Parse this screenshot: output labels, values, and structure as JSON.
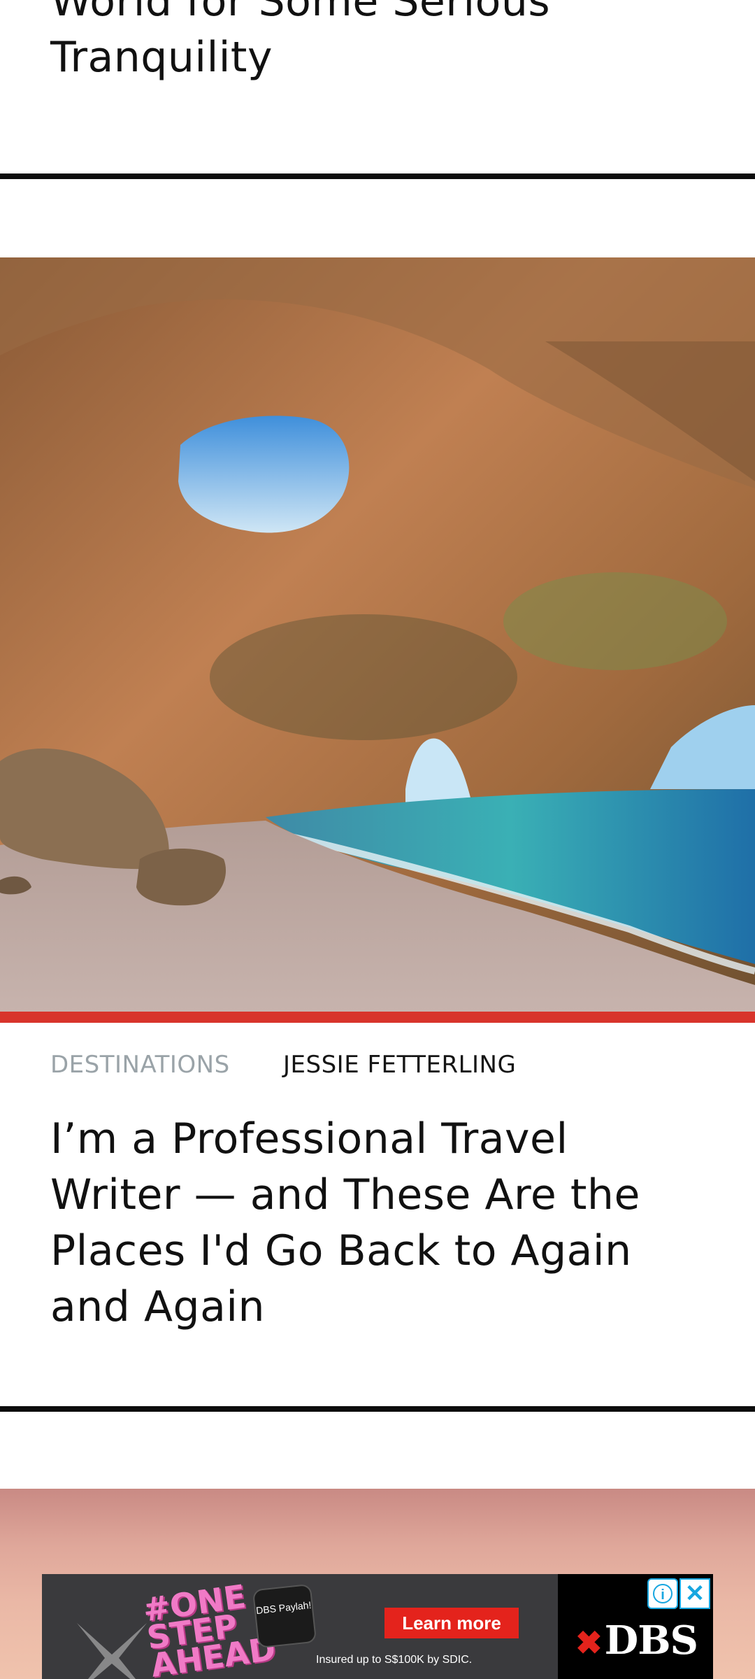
{
  "articles": [
    {
      "title": "World for Some Serious Tranquility"
    },
    {
      "category": "DESTINATIONS",
      "author": "JESSIE FETTERLING",
      "title": "I’m a Professional Travel Writer — and These Are the Places I'd Go Back to Again and Again"
    }
  ],
  "ad": {
    "slogan": "#ONE STEP AHEAD",
    "mark": "DBS Paylah!",
    "cta": "Learn more",
    "note": "Insured up to S$100K by SDIC.",
    "brand": "DBS",
    "info_icon": "info-icon",
    "close_icon": "close-icon"
  },
  "colors": {
    "accent_bar": "#d8342b",
    "category_text": "#9aa3a8",
    "rule": "#0d0d0d",
    "ad_cta": "#e4231c"
  }
}
